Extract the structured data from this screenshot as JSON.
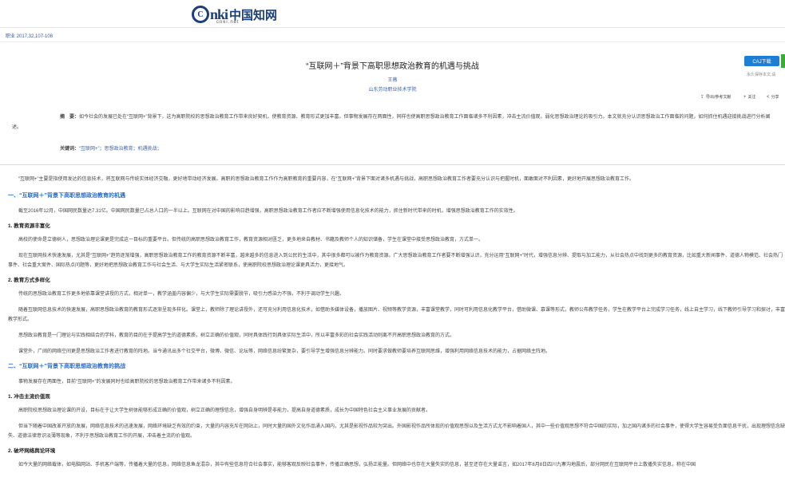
{
  "header": {
    "logo_mark": "C",
    "logo_text": "nki",
    "logo_cn": "中国知网",
    "logo_sub": "cnki.net",
    "journal_info": "职业 2017,32,107-108"
  },
  "article": {
    "title": "“互联网＋”背景下高职思想政治教育的机遇与挑战",
    "author": "王薇",
    "organization": "山东劳动职业技术学院"
  },
  "actions": {
    "caj_download": "CAJ下载",
    "save_note": "永久保存本文,请",
    "export_refs": "导出/参考文献",
    "follow": "关注",
    "share": "分享"
  },
  "abstract": {
    "label": "摘　要：",
    "text": "如今社会的发展已处在“互联网+”背景下，这为高职院校的思想政治教育工作带来良好契机，使教育资源、教育形式更加丰富。但事物发展存在两面性，同样也使高职思想政治教育工作面临诸多不利因素，冲击主流价值观，弱化思想政治理论的吸引力。本文就充分认识思想政治工作面临的问题，如何抓住机遇迎接挑战进行分析阐述。",
    "keywords_label": "关键词：",
    "keywords": "“互联网+”；思想政治教育；机遇挑战；"
  },
  "body": {
    "intro": "“互联网+”主要是指使用发达的信息技术，将互联网与传统实体经济交融，更好地带动经济发展。高职的思想政治教育工作作为高职教育的重要内容，在“互联网+”背景下面对诸多机遇与挑战，高职思想政治教育工作者要充分认识与把握时机，面敢面对不利因素，更好地开展思想政治教育工作。",
    "sec1_title": "一、“互联网＋”背景下高职思想政治教育的机遇",
    "sec1_p1": "截至2016年12月，中国网民数量达7.31亿。中国网民数量已占总人口的一半以上。互联网在对中国的影响日趋增强，高职思想政治教育工作者应不断增强使用信息化技术的能力，抓住新时代带来的时机，增强思想政治教育工作的实效性。",
    "sub1_title": "1. 教育资源丰富化",
    "sub1_p1": "高校的使命是立德树人，思想政治理论课更是完成这一目标的重要平台。但传统的高职思想政治教育工作，教育资源相对匮乏，更多地来自教材、书籍及教师个人的知识储备，学生在课堂中接受思想政治教育，方式单一。",
    "sub1_p2": "现在互联网技术快速发展，尤其是“互联网+”趋势逐渐增强，高职思想政治教育工作的教育资源不断丰富，越来越多的信息进入到公民的生活中，其中很多都可以被作为教育资源。广大思想政治教育工作者要不断增强认识，充分运用“互联网+”时代，增强信息分辨、提取与加工能力，从社会热点中找到更多的教育资源，比如重大新闻事件、道德人物模范、社会热门事件、社会重大案件、国际热点问题等，更好地把思想政治教育工作与社会生活、与大学生实际生活紧密联系，使高职院校思想政治理论课更具活力，更接地气。",
    "sub2_title": "2. 教育方式多样化",
    "sub2_p1": "传统的思想政治教育工作更多地依靠课堂讲授的方式，相对单一，教学涵盖内容偏少，与大学生实际需要脱节，吸引力感染力不强，不利于调动学生兴趣。",
    "sub2_p2": "随着互联网信息技术的快速发展，高职思想政治教育的教育形式逐渐呈现多样化。课堂上，教师除了理论讲授外，还可充分利用信息化技术，如借助多媒体设备，播放图片、视频等教学资源，丰富课堂教学，同时可利用信息化教学平台，借助微课、慕课等形式，教师公布教学任务，学生在教学平台上完成学习任务，线上自主学习，线下教师引导学习和探讨，丰富教学形式。",
    "sub2_p3": "思想政治教育是一门理论与实践相结合的学科，教育的目的在于提高学生的道德素质，树立正确的价值观，同时具体践行到具体实际生活中，所以丰富多彩的社会实践活动则离不开高职思想政治教育的方式。",
    "sub2_p4": "课堂外，广阔的网络空间更是思想政治工作者进行教育的阵地。当今通讯出多个社交平台，微博、微信、论坛等，网络信息纷繁复杂，要引导学生增强信息分辨能力。同时要求做教师要培养互联网思维，增强利用网络信息技术的能力，占据网络主阵地。",
    "sec2_title": "二、“互联网＋”背景下高职思想政治教育的挑战",
    "sec2_p1": "事物发展存在两面性，目前“互联网+”的发展同时也给高职院校的思想政治教育工作带来诸多不利因素。",
    "sub3_title": "1. 冲击主流价值观",
    "sub3_p1": "高职院校思想政治理论课的开设，目标在于让大学生树体能够形成正确的价值观，树立正确的理想信念，增强自身明辨是非能力，提高自身道德素质，成长为中国特色社会主义事业发展的贡献者。",
    "sub3_p2": "但当下随着中国改革开放的发展，网络信息技术的迅速发展，网络环境缺乏有效的约束，大量的内容充斥在网站上，同时大量的国外文化作品涌入国内，尤其是影视作品较为突出。外国影视作品所体现的价值观思想以及生活方式尤不影响着国人，其中一些价值观思想不符合中国的实际，加之国内诸多的社会事件，使得大学生容易受负面信息干扰，出现理想信念缺失、道德法律意识淡薄等现象，不利于思想政治教育工作的开展，冲击着主流的价值观。",
    "sub4_title": "2. 破坏网络舆论环境",
    "sub4_p1": "如今大量的网络载体，如电脑网站、手机客户端等，传播着大量的信息，网络信息鱼龙混杂，其中有些信息符合社会事实，能够客观反映社会事件，传播正确思想，弘扬正能量。但网络中也存在大量失实的信息，甚至还存在大量谣言，如2017年8月8日四川九寨沟地震后，部分网民在互联网平台上散播失实信息，称在中国"
  }
}
